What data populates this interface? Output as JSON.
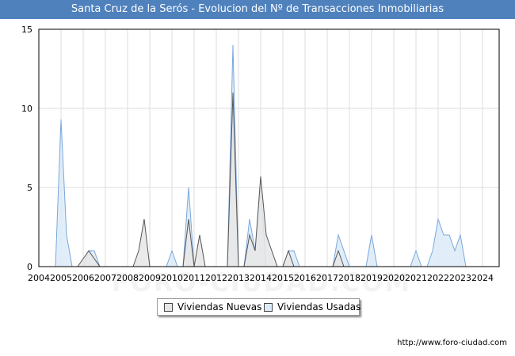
{
  "title": "Santa Cruz de la Serós - Evolucion del Nº de Transacciones Inmobiliarias",
  "watermark": "FORO-CIUDAD.COM",
  "source_url": "http://www.foro-ciudad.com",
  "legend": {
    "items": [
      {
        "label": "Viviendas Nuevas"
      },
      {
        "label": "Viviendas Usadas"
      }
    ]
  },
  "colors": {
    "title_bar": "#4f81bd",
    "nuevas_fill": "#e6e6e6",
    "nuevas_line": "#555555",
    "usadas_fill": "#dcebf8",
    "usadas_line": "#7aa7dc",
    "grid": "#dddddd"
  },
  "chart_data": {
    "type": "area",
    "title": "Santa Cruz de la Serós - Evolucion del Nº de Transacciones Inmobiliarias",
    "xlabel": "",
    "ylabel": "",
    "xlim": [
      2004,
      2024.75
    ],
    "ylim": [
      0,
      15
    ],
    "x_ticks": [
      2004,
      2005,
      2006,
      2007,
      2008,
      2009,
      2010,
      2011,
      2012,
      2013,
      2014,
      2015,
      2016,
      2017,
      2018,
      2019,
      2020,
      2021,
      2022,
      2023,
      2024
    ],
    "y_ticks": [
      0,
      5,
      10,
      15
    ],
    "grid": true,
    "legend_position": "bottom",
    "series": [
      {
        "name": "Viviendas Usadas",
        "points": [
          [
            2004.75,
            0
          ],
          [
            2005,
            9.3
          ],
          [
            2005.25,
            2
          ],
          [
            2005.5,
            0
          ],
          [
            2006.0,
            0
          ],
          [
            2006.25,
            1
          ],
          [
            2006.5,
            1
          ],
          [
            2006.75,
            0
          ],
          [
            2009.75,
            0
          ],
          [
            2010,
            1
          ],
          [
            2010.25,
            0
          ],
          [
            2010.5,
            0
          ],
          [
            2010.75,
            5
          ],
          [
            2011,
            0
          ],
          [
            2012.5,
            0
          ],
          [
            2012.75,
            14
          ],
          [
            2013,
            0
          ],
          [
            2013.25,
            0
          ],
          [
            2013.5,
            3
          ],
          [
            2013.75,
            1
          ],
          [
            2014,
            5
          ],
          [
            2014.25,
            0
          ],
          [
            2015,
            0
          ],
          [
            2015.25,
            1
          ],
          [
            2015.5,
            1
          ],
          [
            2015.75,
            0
          ],
          [
            2017.25,
            0
          ],
          [
            2017.5,
            2
          ],
          [
            2018,
            0
          ],
          [
            2018.75,
            0
          ],
          [
            2019,
            2
          ],
          [
            2019.25,
            0
          ],
          [
            2020.75,
            0
          ],
          [
            2021,
            1
          ],
          [
            2021.25,
            0
          ],
          [
            2021.5,
            0
          ],
          [
            2021.75,
            1
          ],
          [
            2022,
            3
          ],
          [
            2022.25,
            2
          ],
          [
            2022.5,
            2
          ],
          [
            2022.75,
            1
          ],
          [
            2023,
            2
          ],
          [
            2023.25,
            0
          ]
        ]
      },
      {
        "name": "Viviendas Nuevas",
        "points": [
          [
            2005.75,
            0
          ],
          [
            2006.25,
            1
          ],
          [
            2006.75,
            0
          ],
          [
            2008.25,
            0
          ],
          [
            2008.5,
            1
          ],
          [
            2008.75,
            3
          ],
          [
            2009,
            0
          ],
          [
            2010.5,
            0
          ],
          [
            2010.75,
            3
          ],
          [
            2011,
            0
          ],
          [
            2011.25,
            2
          ],
          [
            2011.5,
            0
          ],
          [
            2012.5,
            0
          ],
          [
            2012.75,
            11
          ],
          [
            2013,
            0
          ],
          [
            2013.25,
            0
          ],
          [
            2013.5,
            2
          ],
          [
            2013.75,
            1
          ],
          [
            2014,
            5.7
          ],
          [
            2014.25,
            2
          ],
          [
            2014.5,
            1
          ],
          [
            2014.75,
            0
          ],
          [
            2015,
            0
          ],
          [
            2015.25,
            1
          ],
          [
            2015.5,
            0
          ],
          [
            2017.25,
            0
          ],
          [
            2017.5,
            1
          ],
          [
            2017.75,
            0
          ]
        ]
      }
    ]
  }
}
